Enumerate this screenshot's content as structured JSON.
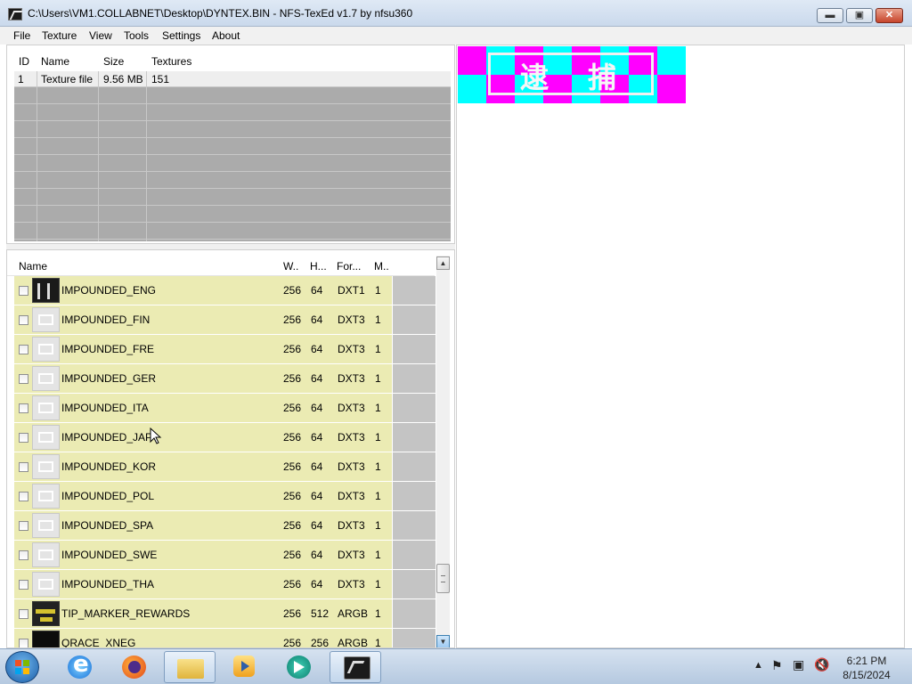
{
  "window": {
    "title": "C:\\Users\\VM1.COLLABNET\\Desktop\\DYNTEX.BIN - NFS-TexEd v1.7 by nfsu360"
  },
  "menu": [
    "File",
    "Texture",
    "View",
    "Tools",
    "Settings",
    "About"
  ],
  "file_table": {
    "headers": [
      "ID",
      "Name",
      "Size",
      "Textures"
    ],
    "rows": [
      {
        "id": "1",
        "name": "Texture file",
        "size": "9.56 MB",
        "textures": "151"
      }
    ]
  },
  "texture_list": {
    "headers": [
      "Name",
      "W..",
      "H...",
      "For...",
      "M.."
    ],
    "rows": [
      {
        "name": "IMPOUNDED_ENG",
        "w": "256",
        "h": "64",
        "format": "DXT1",
        "m": "1",
        "thumb": "dark"
      },
      {
        "name": "IMPOUNDED_FIN",
        "w": "256",
        "h": "64",
        "format": "DXT3",
        "m": "1",
        "thumb": "light"
      },
      {
        "name": "IMPOUNDED_FRE",
        "w": "256",
        "h": "64",
        "format": "DXT3",
        "m": "1",
        "thumb": "light"
      },
      {
        "name": "IMPOUNDED_GER",
        "w": "256",
        "h": "64",
        "format": "DXT3",
        "m": "1",
        "thumb": "light"
      },
      {
        "name": "IMPOUNDED_ITA",
        "w": "256",
        "h": "64",
        "format": "DXT3",
        "m": "1",
        "thumb": "light"
      },
      {
        "name": "IMPOUNDED_JAP",
        "w": "256",
        "h": "64",
        "format": "DXT3",
        "m": "1",
        "thumb": "light"
      },
      {
        "name": "IMPOUNDED_KOR",
        "w": "256",
        "h": "64",
        "format": "DXT3",
        "m": "1",
        "thumb": "light"
      },
      {
        "name": "IMPOUNDED_POL",
        "w": "256",
        "h": "64",
        "format": "DXT3",
        "m": "1",
        "thumb": "light"
      },
      {
        "name": "IMPOUNDED_SPA",
        "w": "256",
        "h": "64",
        "format": "DXT3",
        "m": "1",
        "thumb": "light"
      },
      {
        "name": "IMPOUNDED_SWE",
        "w": "256",
        "h": "64",
        "format": "DXT3",
        "m": "1",
        "thumb": "light"
      },
      {
        "name": "IMPOUNDED_THA",
        "w": "256",
        "h": "64",
        "format": "DXT3",
        "m": "1",
        "thumb": "light"
      },
      {
        "name": "TIP_MARKER_REWARDS",
        "w": "256",
        "h": "512",
        "format": "ARGB",
        "m": "1",
        "thumb": "gold"
      },
      {
        "name": "QRACE_XNEG",
        "w": "256",
        "h": "256",
        "format": "ARGB",
        "m": "1",
        "thumb": "black"
      }
    ]
  },
  "preview": {
    "glyph_left": "逮",
    "glyph_right": "捕",
    "colors": {
      "magenta": "#ff00ff",
      "cyan": "#00ffff"
    }
  },
  "taskbar": {
    "apps": [
      "internet-explorer-icon",
      "firefox-icon",
      "file-explorer-icon",
      "media-player-icon",
      "media-center-icon",
      "nfs-texed-icon"
    ],
    "time": "6:21 PM",
    "date": "8/15/2024"
  }
}
